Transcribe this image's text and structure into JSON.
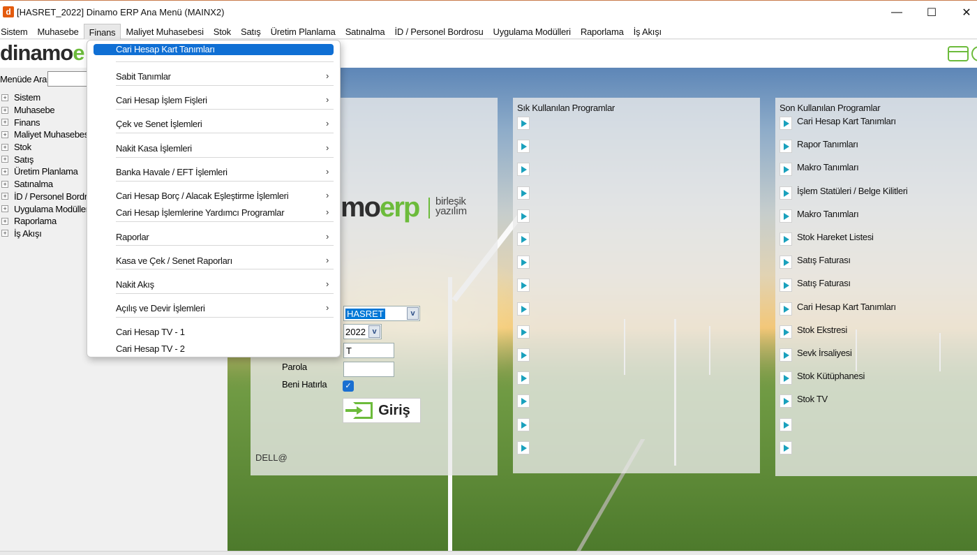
{
  "window": {
    "app_icon": "d",
    "title": "[HASRET_2022] Dinamo ERP Ana Menü (MAINX2)",
    "controls": {
      "minimize": "—",
      "maximize": "☐",
      "close": "✕"
    }
  },
  "menubar": {
    "items": [
      "Sistem",
      "Muhasebe",
      "Finans",
      "Maliyet Muhasebesi",
      "Stok",
      "Satış",
      "Üretim Planlama",
      "Satınalma",
      "İD / Personel Bordrosu",
      "Uygulama Modülleri",
      "Raporlama",
      "İş Akışı"
    ],
    "active": "Finans"
  },
  "logo": {
    "text_dark": "dinamo",
    "text_green": "e"
  },
  "toolbar": {
    "icons": [
      "window-layout-icon",
      "refresh-icon"
    ]
  },
  "sidebar": {
    "search_label": "Menüde Ara",
    "search_value": "",
    "expand_glyph": "+",
    "tree": [
      "Sistem",
      "Muhasebe",
      "Finans",
      "Maliyet Muhasebesi",
      "Stok",
      "Satış",
      "Üretim Planlama",
      "Satınalma",
      "İD / Personel Bordrosu",
      "Uygulama Modülleri",
      "Raporlama",
      "İş Akışı"
    ]
  },
  "finans_menu": {
    "items": [
      {
        "label": "Cari Hesap Kart Tanımları",
        "submenu": false,
        "highlighted": true
      },
      {
        "label": "Sabit Tanımlar",
        "submenu": true
      },
      {
        "label": "Cari Hesap İşlem Fişleri",
        "submenu": true
      },
      {
        "label": "Çek ve Senet İşlemleri",
        "submenu": true
      },
      {
        "label": "Nakit Kasa İşlemleri",
        "submenu": true
      },
      {
        "label": "Banka Havale / EFT İşlemleri",
        "submenu": true
      },
      {
        "label": "Cari Hesap Borç / Alacak Eşleştirme İşlemleri",
        "submenu": true
      },
      {
        "label": "Cari Hesap İşlemlerine Yardımcı Programlar",
        "submenu": true
      },
      {
        "label": "Raporlar",
        "submenu": true
      },
      {
        "label": "Kasa ve Çek / Senet Raporları",
        "submenu": true
      },
      {
        "label": "Nakit Akış",
        "submenu": true
      },
      {
        "label": "Açılış ve Devir İşlemleri",
        "submenu": true
      },
      {
        "label": "Cari Hesap TV - 1",
        "submenu": false
      },
      {
        "label": "Cari Hesap TV - 2",
        "submenu": false
      }
    ],
    "chevron": "›"
  },
  "login": {
    "brand": {
      "dark": "mo",
      "green": "erp",
      "sub1": "birleşik",
      "sub2": "yazılım"
    },
    "company_value": "HASRET",
    "year_value": "2022",
    "user_value": "T",
    "password_label": "Parola",
    "password_value": "",
    "remember_label": "Beni Hatırla",
    "remember_checked": true,
    "login_button": "Giriş",
    "machine_user": "DELL@",
    "combo_arrow": "v",
    "check_glyph": "✓"
  },
  "frequent_programs": {
    "title": "Sık Kullanılan Programlar",
    "count": 15
  },
  "recent_programs": {
    "title": "Son Kullanılan Programlar",
    "items": [
      "Cari Hesap Kart Tanımları",
      "Rapor Tanımları",
      "Makro Tanımları",
      "İşlem Statüleri / Belge Kilitleri",
      "Makro Tanımları",
      "Stok Hareket Listesi",
      "Satış Faturası",
      "Satış Faturası",
      "Cari Hesap Kart Tanımları",
      "Stok Ekstresi",
      "Sevk İrsaliyesi",
      "Stok Kütüphanesi",
      "Stok TV",
      "",
      ""
    ]
  },
  "colors": {
    "accent_green": "#6cbb3b",
    "menu_highlight": "#0f6fd4",
    "arrow_teal": "#1aa1bd"
  }
}
